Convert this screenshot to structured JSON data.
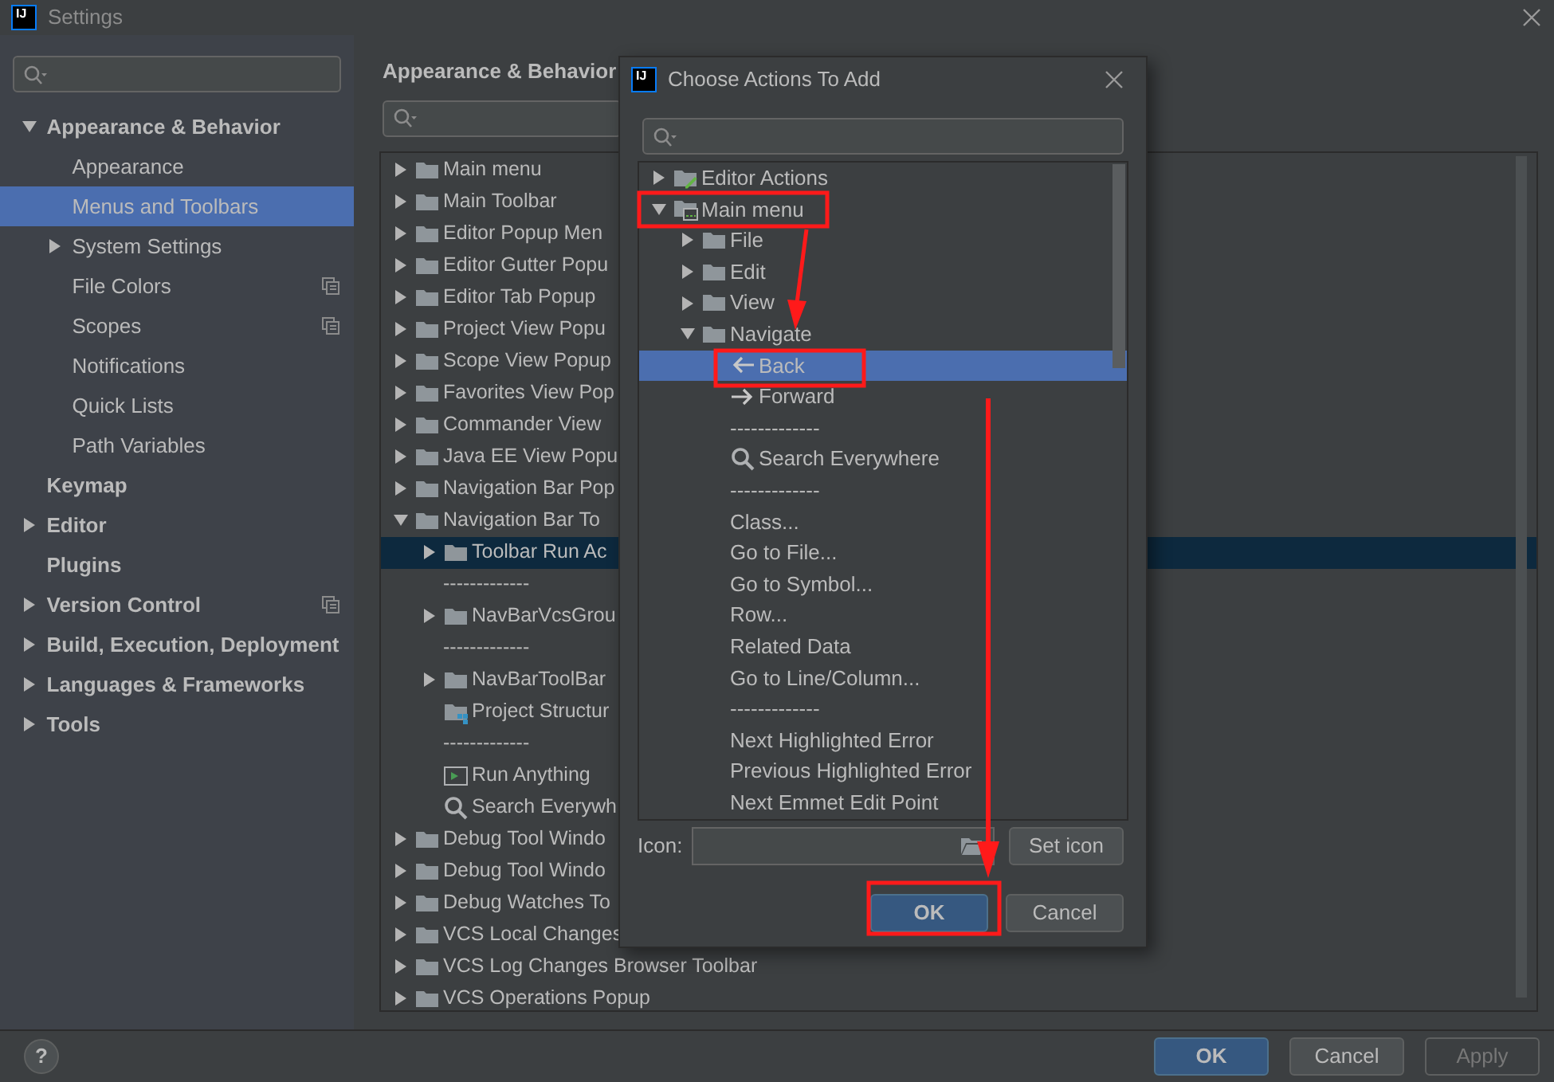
{
  "window": {
    "logo": "IJ",
    "title": "Settings"
  },
  "sidebar": {
    "items": [
      {
        "label": "Appearance & Behavior",
        "expanded": true,
        "selected": false,
        "project_level": false,
        "children": [
          {
            "label": "Appearance",
            "selected": false,
            "project_level": false
          },
          {
            "label": "Menus and Toolbars",
            "selected": true,
            "project_level": false
          },
          {
            "label": "System Settings",
            "expanded": false,
            "selected": false,
            "project_level": false
          },
          {
            "label": "File Colors",
            "selected": false,
            "project_level": true
          },
          {
            "label": "Scopes",
            "selected": false,
            "project_level": true
          },
          {
            "label": "Notifications",
            "selected": false,
            "project_level": false
          },
          {
            "label": "Quick Lists",
            "selected": false,
            "project_level": false
          },
          {
            "label": "Path Variables",
            "selected": false,
            "project_level": false
          }
        ]
      },
      {
        "label": "Keymap",
        "selected": false,
        "project_level": false
      },
      {
        "label": "Editor",
        "expanded": false,
        "selected": false,
        "project_level": false
      },
      {
        "label": "Plugins",
        "selected": false,
        "project_level": false
      },
      {
        "label": "Version Control",
        "expanded": false,
        "selected": false,
        "project_level": true
      },
      {
        "label": "Build, Execution, Deployment",
        "expanded": false,
        "selected": false,
        "project_level": false
      },
      {
        "label": "Languages & Frameworks",
        "expanded": false,
        "selected": false,
        "project_level": false
      },
      {
        "label": "Tools",
        "expanded": false,
        "selected": false,
        "project_level": false
      }
    ]
  },
  "main": {
    "breadcrumb": "Appearance & Behavior",
    "tree": [
      {
        "kind": "folder",
        "label": "Main menu",
        "expanded": false,
        "selected": false
      },
      {
        "kind": "folder",
        "label": "Main Toolbar",
        "expanded": false,
        "selected": false
      },
      {
        "kind": "folder",
        "label": "Editor Popup Men",
        "expanded": false,
        "selected": false
      },
      {
        "kind": "folder",
        "label": "Editor Gutter Popu",
        "expanded": false,
        "selected": false
      },
      {
        "kind": "folder",
        "label": "Editor Tab Popup",
        "expanded": false,
        "selected": false
      },
      {
        "kind": "folder",
        "label": "Project View Popu",
        "expanded": false,
        "selected": false
      },
      {
        "kind": "folder",
        "label": "Scope View Popup",
        "expanded": false,
        "selected": false
      },
      {
        "kind": "folder",
        "label": "Favorites View Pop",
        "expanded": false,
        "selected": false
      },
      {
        "kind": "folder",
        "label": "Commander View",
        "expanded": false,
        "selected": false
      },
      {
        "kind": "folder",
        "label": "Java EE View Popu",
        "expanded": false,
        "selected": false
      },
      {
        "kind": "folder",
        "label": "Navigation Bar Pop",
        "expanded": false,
        "selected": false
      },
      {
        "kind": "folder",
        "label": "Navigation Bar To",
        "expanded": true,
        "selected": false,
        "children": [
          {
            "kind": "folder",
            "label": "Toolbar Run Ac",
            "expanded": false,
            "selected": true
          },
          {
            "kind": "separator",
            "label": "-------------",
            "selected": false
          },
          {
            "kind": "folder",
            "label": "NavBarVcsGrou",
            "expanded": false,
            "selected": false
          },
          {
            "kind": "separator",
            "label": "-------------",
            "selected": false
          },
          {
            "kind": "folder",
            "label": "NavBarToolBar",
            "expanded": false,
            "selected": false
          },
          {
            "kind": "structure",
            "label": "Project Structur",
            "selected": false
          },
          {
            "kind": "separator",
            "label": "-------------",
            "selected": false
          },
          {
            "kind": "run",
            "label": "Run Anything",
            "selected": false
          },
          {
            "kind": "search",
            "label": "Search Everywh",
            "selected": false
          }
        ]
      },
      {
        "kind": "folder",
        "label": "Debug Tool Windo",
        "expanded": false,
        "selected": false
      },
      {
        "kind": "folder",
        "label": "Debug Tool Windo",
        "expanded": false,
        "selected": false
      },
      {
        "kind": "folder",
        "label": "Debug Watches To",
        "expanded": false,
        "selected": false
      },
      {
        "kind": "folder",
        "label": "VCS Local Changes",
        "expanded": false,
        "selected": false
      },
      {
        "kind": "folder",
        "label": "VCS Log Changes Browser Toolbar",
        "expanded": false,
        "selected": false
      },
      {
        "kind": "folder",
        "label": "VCS Operations Popup",
        "expanded": false,
        "selected": false
      }
    ]
  },
  "footer": {
    "help": "?",
    "buttons": [
      {
        "label": "OK",
        "kind": "default",
        "disabled": false
      },
      {
        "label": "Cancel",
        "kind": "normal",
        "disabled": false
      },
      {
        "label": "Apply",
        "kind": "normal",
        "disabled": true
      }
    ]
  },
  "dialog": {
    "logo": "IJ",
    "title": "Choose Actions To Add",
    "tree": [
      {
        "kind": "editor-actions",
        "label": "Editor Actions",
        "expanded": false,
        "selected": false
      },
      {
        "kind": "main-menu",
        "label": "Main menu",
        "expanded": true,
        "selected": false,
        "children": [
          {
            "kind": "folder",
            "label": "File",
            "expanded": false,
            "selected": false
          },
          {
            "kind": "folder",
            "label": "Edit",
            "expanded": false,
            "selected": false
          },
          {
            "kind": "folder",
            "label": "View",
            "expanded": false,
            "selected": false
          },
          {
            "kind": "folder",
            "label": "Navigate",
            "expanded": true,
            "selected": false,
            "children": [
              {
                "kind": "back",
                "label": "Back",
                "selected": true
              },
              {
                "kind": "forward",
                "label": "Forward",
                "selected": false
              },
              {
                "kind": "separator",
                "label": "-------------",
                "selected": false
              },
              {
                "kind": "search",
                "label": "Search Everywhere",
                "selected": false
              },
              {
                "kind": "separator",
                "label": "-------------",
                "selected": false
              },
              {
                "kind": "plain",
                "label": "Class...",
                "selected": false
              },
              {
                "kind": "plain",
                "label": "Go to File...",
                "selected": false
              },
              {
                "kind": "plain",
                "label": "Go to Symbol...",
                "selected": false
              },
              {
                "kind": "plain",
                "label": "Row...",
                "selected": false
              },
              {
                "kind": "plain",
                "label": "Related Data",
                "selected": false
              },
              {
                "kind": "plain",
                "label": "Go to Line/Column...",
                "selected": false
              },
              {
                "kind": "separator",
                "label": "-------------",
                "selected": false
              },
              {
                "kind": "plain",
                "label": "Next Highlighted Error",
                "selected": false
              },
              {
                "kind": "plain",
                "label": "Previous Highlighted Error",
                "selected": false
              },
              {
                "kind": "plain",
                "label": "Next Emmet Edit Point",
                "selected": false
              }
            ]
          }
        ]
      }
    ],
    "icon_label": "Icon:",
    "set_icon": "Set icon",
    "buttons": [
      {
        "label": "OK",
        "kind": "default",
        "disabled": false
      },
      {
        "label": "Cancel",
        "kind": "normal",
        "disabled": false
      }
    ]
  }
}
